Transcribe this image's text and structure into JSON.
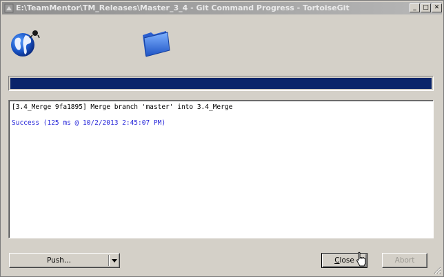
{
  "window": {
    "title": "E:\\TeamMentor\\TM_Releases\\Master_3_4 - Git Command Progress - TortoiseGit",
    "min_glyph": "_",
    "max_glyph": "□",
    "close_glyph": "✕"
  },
  "progress": {
    "value_percent": 100,
    "color": "#0a246a"
  },
  "log": {
    "lines": [
      {
        "text": "[3.4_Merge 9fa1895] Merge branch 'master' into 3.4_Merge",
        "color": "#000000"
      },
      {
        "text": "Success (125 ms @ 10/2/2013 2:45:07 PM)",
        "color": "#1f1fd8"
      }
    ]
  },
  "buttons": {
    "push_label": "Push...",
    "close_label_accel": "C",
    "close_label_rest": "lose",
    "abort_label": "Abort"
  },
  "icons": {
    "globe": "globe-network-icon",
    "folder": "folder-icon",
    "app": "tortoisegit-icon"
  }
}
